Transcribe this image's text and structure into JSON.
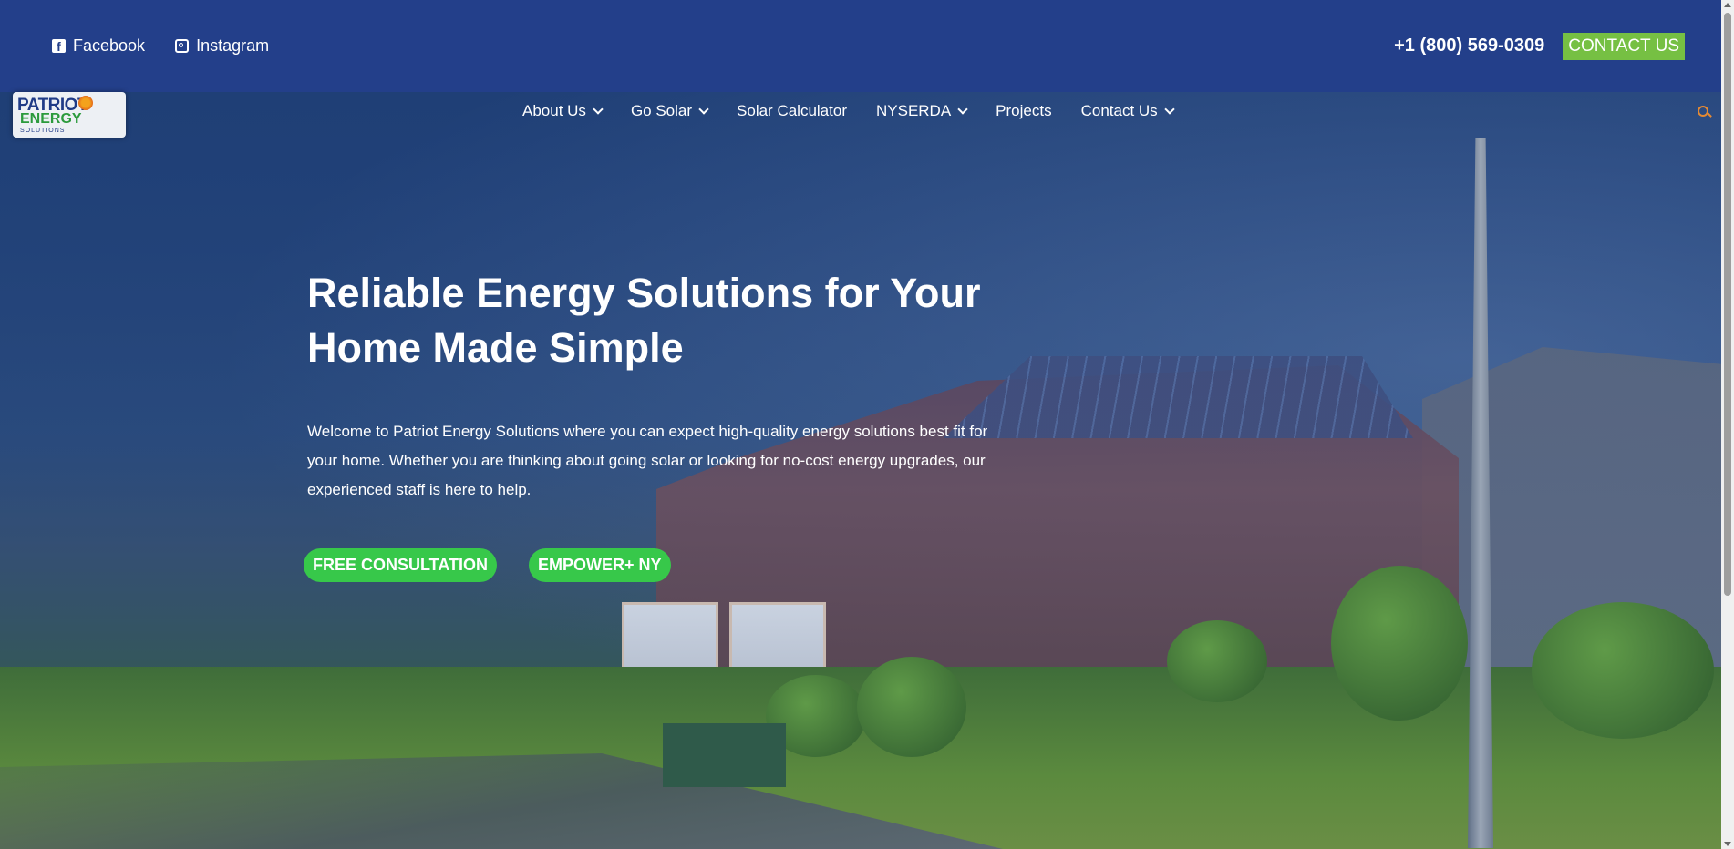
{
  "topbar": {
    "social": [
      {
        "label": "Facebook",
        "icon": "facebook-icon"
      },
      {
        "label": "Instagram",
        "icon": "instagram-icon"
      }
    ],
    "phone": "+1 (800) 569-0309",
    "contact_label": "CONTACT US"
  },
  "logo": {
    "line1": "PATRIOT",
    "line2": "ENERGY",
    "line3": "SOLUTIONS"
  },
  "nav": {
    "items": [
      {
        "label": "About Us",
        "has_dropdown": true
      },
      {
        "label": "Go Solar",
        "has_dropdown": true
      },
      {
        "label": "Solar Calculator",
        "has_dropdown": false
      },
      {
        "label": "NYSERDA",
        "has_dropdown": true
      },
      {
        "label": "Projects",
        "has_dropdown": false
      },
      {
        "label": "Contact Us",
        "has_dropdown": true
      }
    ],
    "search_icon": "search-icon"
  },
  "hero": {
    "headline_line1": "Reliable Energy Solutions for Your",
    "headline_line2": "Home Made Simple",
    "intro": "Welcome to Patriot Energy Solutions where you can expect high-quality energy solutions best fit for your home. Whether you are thinking about going solar or looking for no-cost energy upgrades, our experienced staff is here to help.",
    "cta_primary": "FREE CONSULTATION",
    "cta_secondary": "EMPOWER+ NY"
  },
  "colors": {
    "topbar": "#233f8a",
    "accent_green": "#76c043",
    "cta_green": "#37c84a",
    "search_orange": "#e58a33"
  }
}
